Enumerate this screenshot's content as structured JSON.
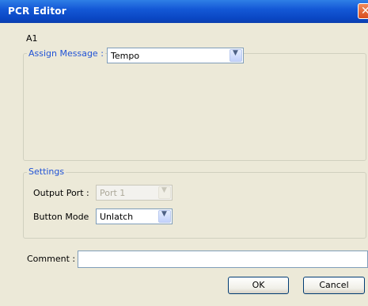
{
  "window": {
    "title": "PCR Editor",
    "close_glyph": "✕"
  },
  "record_label": "A1",
  "assign_group": {
    "assign_message_label": "Assign Message :",
    "assign_message_value": "Tempo"
  },
  "settings_group": {
    "title": "Settings",
    "output_port_label": "Output Port :",
    "output_port_value": "Port 1",
    "button_mode_label": "Button Mode",
    "button_mode_value": "Unlatch"
  },
  "comment": {
    "label": "Comment :",
    "value": ""
  },
  "buttons": {
    "ok_label": "OK",
    "cancel_label": "Cancel"
  },
  "icons": {
    "dropdown": "chevron-down-icon",
    "close": "close-icon"
  }
}
